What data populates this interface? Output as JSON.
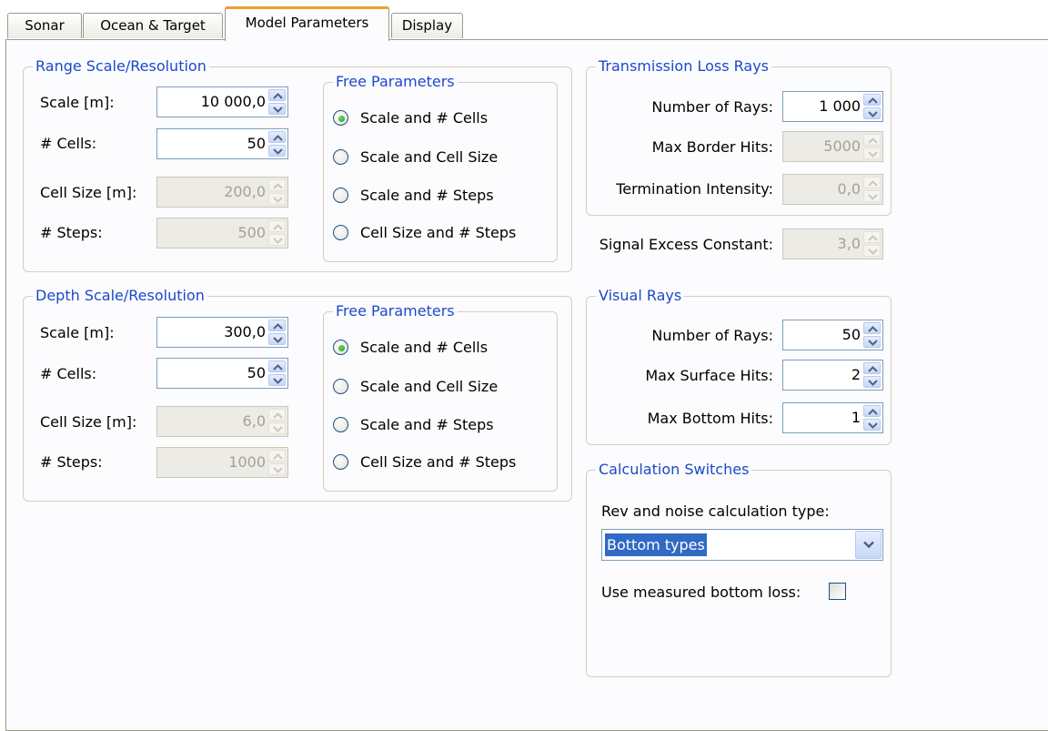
{
  "tabs": [
    "Sonar",
    "Ocean & Target",
    "Model Parameters",
    "Display"
  ],
  "range": {
    "title": "Range Scale/Resolution",
    "scale_label": "Scale [m]:",
    "scale_value": "10 000,0",
    "cells_label": "# Cells:",
    "cells_value": "50",
    "cellsize_label": "Cell Size [m]:",
    "cellsize_value": "200,0",
    "steps_label": "# Steps:",
    "steps_value": "500",
    "free": {
      "title": "Free Parameters",
      "options": [
        "Scale and # Cells",
        "Scale and Cell Size",
        "Scale and # Steps",
        "Cell Size and # Steps"
      ],
      "selected": 0
    }
  },
  "depth": {
    "title": "Depth Scale/Resolution",
    "scale_label": "Scale [m]:",
    "scale_value": "300,0",
    "cells_label": "# Cells:",
    "cells_value": "50",
    "cellsize_label": "Cell Size [m]:",
    "cellsize_value": "6,0",
    "steps_label": "# Steps:",
    "steps_value": "1000",
    "free": {
      "title": "Free Parameters",
      "options": [
        "Scale and # Cells",
        "Scale and Cell Size",
        "Scale and # Steps",
        "Cell Size and # Steps"
      ],
      "selected": 0
    }
  },
  "tl": {
    "title": "Transmission Loss Rays",
    "rays_label": "Number of Rays:",
    "rays_value": "1 000",
    "border_label": "Max Border Hits:",
    "border_value": "5000",
    "term_label": "Termination Intensity:",
    "term_value": "0,0"
  },
  "sec": {
    "label": "Signal Excess Constant:",
    "value": "3,0"
  },
  "visual": {
    "title": "Visual Rays",
    "rays_label": "Number of Rays:",
    "rays_value": "50",
    "surface_label": "Max Surface Hits:",
    "surface_value": "2",
    "bottom_label": "Max Bottom Hits:",
    "bottom_value": "1"
  },
  "calc": {
    "title": "Calculation Switches",
    "type_label": "Rev and noise calculation type:",
    "type_value": "Bottom types",
    "measured_label": "Use measured bottom loss:",
    "measured_checked": false
  },
  "colors": {
    "group_title": "#1c49c9",
    "selection": "#316ac5",
    "tab_accent": "#f0a030"
  }
}
